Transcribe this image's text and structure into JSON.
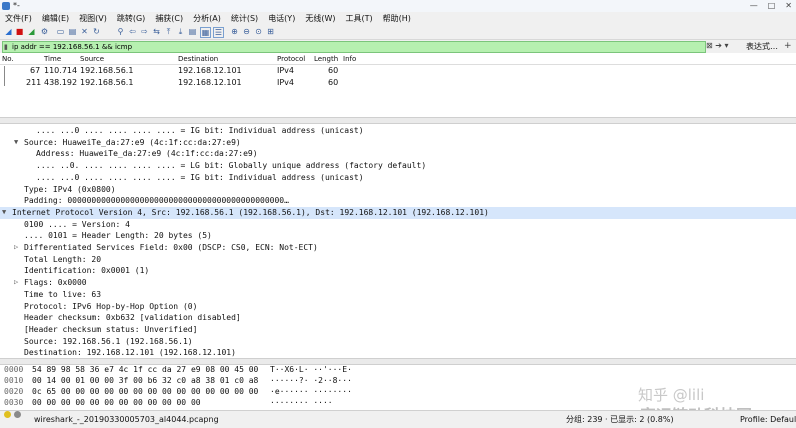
{
  "window": {
    "title": "*-",
    "buttons": [
      "—",
      "□",
      "✕"
    ]
  },
  "menu": [
    "文件(F)",
    "编辑(E)",
    "视图(V)",
    "跳转(G)",
    "捕获(C)",
    "分析(A)",
    "统计(S)",
    "电话(Y)",
    "无线(W)",
    "工具(T)",
    "帮助(H)"
  ],
  "filter": {
    "value": "ip addr == 192.168.56.1 && icmp",
    "apply_label": "表达式…",
    "plus": "+"
  },
  "packet_list": {
    "headers": [
      "No.",
      "Time",
      "Source",
      "Destination",
      "Protocol",
      "Length",
      "Info"
    ],
    "rows": [
      {
        "no": "67",
        "time": "110.714",
        "src": "192.168.56.1",
        "dst": "192.168.12.101",
        "proto": "IPv4",
        "len": "60",
        "info": ""
      },
      {
        "no": "211",
        "time": "438.192",
        "src": "192.168.56.1",
        "dst": "192.168.12.101",
        "proto": "IPv4",
        "len": "60",
        "info": ""
      }
    ]
  },
  "details": [
    {
      "indent": 2,
      "arrow": "",
      "text": ".... ...0 .... .... .... .... = IG bit: Individual address (unicast)"
    },
    {
      "indent": 1,
      "arrow": "▼",
      "text": "Source: HuaweiTe_da:27:e9 (4c:1f:cc:da:27:e9)"
    },
    {
      "indent": 2,
      "arrow": "",
      "text": "Address: HuaweiTe_da:27:e9 (4c:1f:cc:da:27:e9)"
    },
    {
      "indent": 2,
      "arrow": "",
      "text": ".... ..0. .... .... .... .... = LG bit: Globally unique address (factory default)"
    },
    {
      "indent": 2,
      "arrow": "",
      "text": ".... ...0 .... .... .... .... = IG bit: Individual address (unicast)"
    },
    {
      "indent": 1,
      "arrow": "",
      "text": "Type: IPv4 (0x0800)"
    },
    {
      "indent": 1,
      "arrow": "",
      "text": "Padding: 000000000000000000000000000000000000000000000…"
    },
    {
      "indent": 0,
      "arrow": "▼",
      "text": "Internet Protocol Version 4, Src: 192.168.56.1 (192.168.56.1), Dst: 192.168.12.101 (192.168.12.101)"
    },
    {
      "indent": 1,
      "arrow": "",
      "text": "0100 .... = Version: 4"
    },
    {
      "indent": 1,
      "arrow": "",
      "text": ".... 0101 = Header Length: 20 bytes (5)"
    },
    {
      "indent": 1,
      "arrow": "▷",
      "text": "Differentiated Services Field: 0x00 (DSCP: CS0, ECN: Not-ECT)"
    },
    {
      "indent": 1,
      "arrow": "",
      "text": "Total Length: 20"
    },
    {
      "indent": 1,
      "arrow": "",
      "text": "Identification: 0x0001 (1)"
    },
    {
      "indent": 1,
      "arrow": "▷",
      "text": "Flags: 0x0000"
    },
    {
      "indent": 1,
      "arrow": "",
      "text": "Time to live: 63"
    },
    {
      "indent": 1,
      "arrow": "",
      "text": "Protocol: IPv6 Hop-by-Hop Option (0)"
    },
    {
      "indent": 1,
      "arrow": "",
      "text": "Header checksum: 0xb632 [validation disabled]"
    },
    {
      "indent": 1,
      "arrow": "",
      "text": "[Header checksum status: Unverified]"
    },
    {
      "indent": 1,
      "arrow": "",
      "text": "Source: 192.168.56.1 (192.168.56.1)"
    },
    {
      "indent": 1,
      "arrow": "",
      "text": "Destination: 192.168.12.101 (192.168.12.101)"
    }
  ],
  "bytes": [
    {
      "offset": "0000",
      "hex": "54 89 98 58 36 e7 4c 1f  cc da 27 e9 08 00 45 00",
      "ascii": "T··X6·L·  ··'···E·"
    },
    {
      "offset": "0010",
      "hex": "00 14 00 01 00 00 3f 00  b6 32 c0 a8 38 01 c0 a8",
      "ascii": "······?·  ·2··8···"
    },
    {
      "offset": "0020",
      "hex": "0c 65 00 00 00 00 00 00  00 00 00 00 00 00 00 00",
      "ascii": "·e······  ········"
    },
    {
      "offset": "0030",
      "hex": "00 00 00 00 00 00 00 00  00 00 00 00",
      "ascii": "········  ····"
    }
  ],
  "status": {
    "file": "wireshark_-_20190330005703_al4044.pcapng",
    "packets": "分组: 239 · 已显示: 2 (0.8%)",
    "profile": "Profile: Default"
  },
  "watermark": {
    "line1": "知乎 @lili",
    "line2": "富运链动科技网"
  },
  "colors": {
    "filter_bg": "#b6f0b0",
    "selected_row": "#d6e6fb"
  }
}
